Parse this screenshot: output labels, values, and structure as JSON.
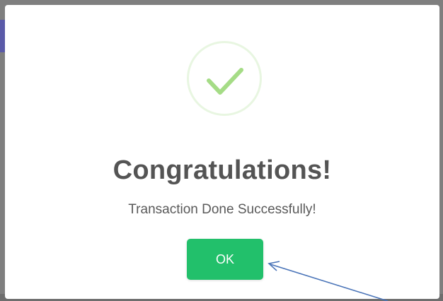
{
  "dialog": {
    "icon": "checkmark-icon",
    "title": "Congratulations!",
    "message": "Transaction Done Successfully!",
    "ok_label": "OK"
  },
  "colors": {
    "success_green": "#22c06b",
    "check_green": "#a5dc86",
    "annotation_arrow": "#4a74b8"
  }
}
